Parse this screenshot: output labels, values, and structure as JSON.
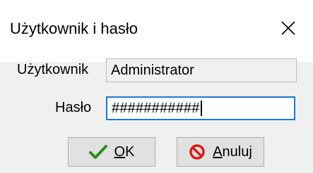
{
  "dialog": {
    "title": "Użytkownik i hasło",
    "close_icon": "close-icon"
  },
  "form": {
    "user_label": "Użytkownik",
    "user_value": "Administrator",
    "password_label": "Hasło",
    "password_value": "###########"
  },
  "buttons": {
    "ok_mnemonic": "O",
    "ok_rest": "K",
    "ok_icon": "check-icon",
    "cancel_mnemonic": "A",
    "cancel_rest": "nuluj",
    "cancel_icon": "no-entry-icon"
  },
  "colors": {
    "focus_border": "#1c79d6",
    "check_green": "#2e8b1f",
    "cancel_red": "#d81e1e"
  }
}
